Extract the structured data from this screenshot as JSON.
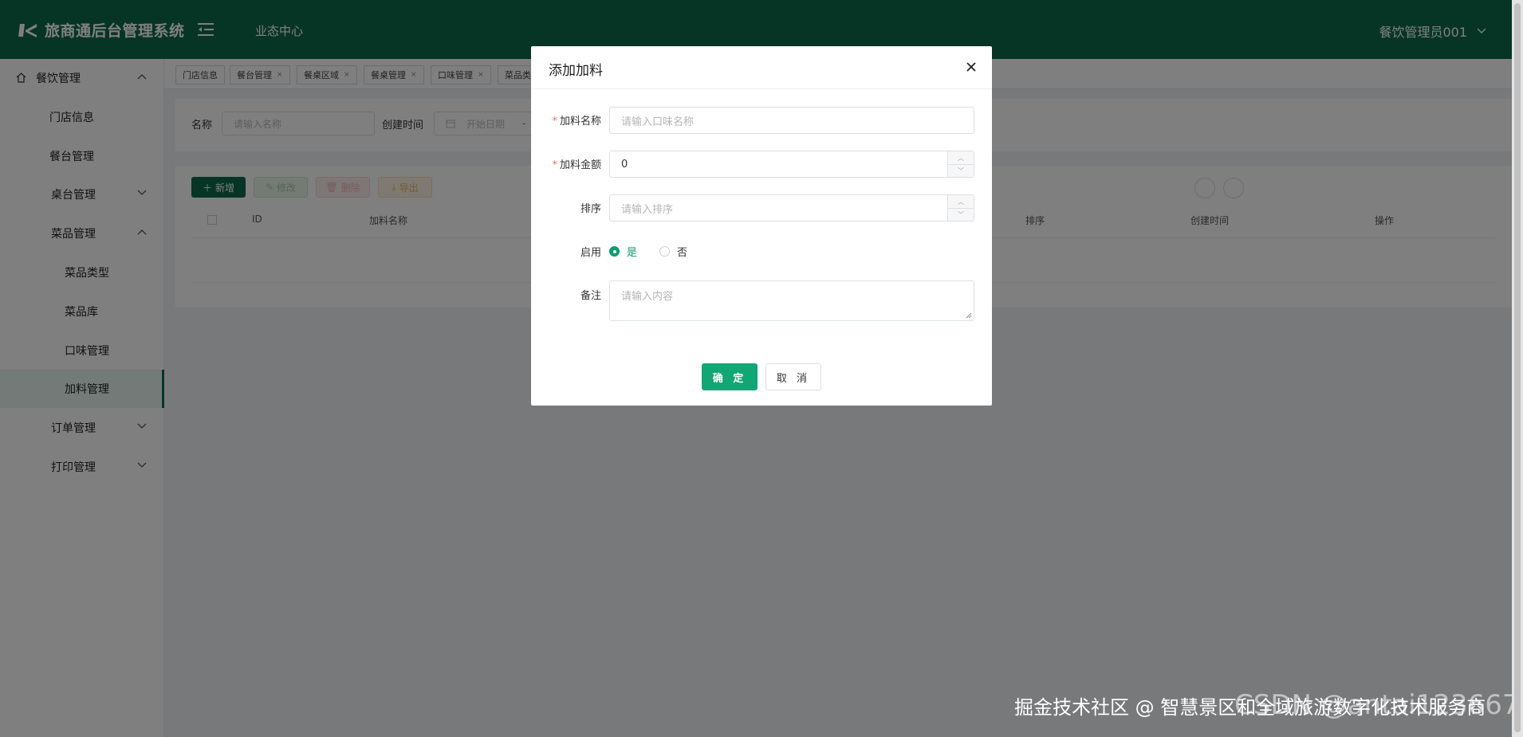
{
  "header": {
    "app_title": "旅商通后台管理系统",
    "center_label": "业态中心",
    "user_name": "餐饮管理员001"
  },
  "sidebar": {
    "items": [
      {
        "label": "餐饮管理",
        "expanded": true
      },
      {
        "label": "门店信息"
      },
      {
        "label": "餐台管理"
      },
      {
        "label": "桌台管理",
        "expanded": false
      },
      {
        "label": "菜品管理",
        "expanded": true
      },
      {
        "label": "菜品类型"
      },
      {
        "label": "菜品库"
      },
      {
        "label": "口味管理"
      },
      {
        "label": "加料管理",
        "active": true
      },
      {
        "label": "订单管理",
        "expanded": false
      },
      {
        "label": "打印管理",
        "expanded": false
      }
    ]
  },
  "tags": [
    "门店信息",
    "餐台管理",
    "餐桌区域",
    "餐桌管理",
    "口味管理",
    "菜品类"
  ],
  "search": {
    "name_label": "名称",
    "name_placeholder": "请输入名称",
    "created_label": "创建时间",
    "start_placeholder": "开始日期",
    "separator": "-"
  },
  "toolbar": {
    "add": "新增",
    "edit": "修改",
    "delete": "删除",
    "export": "导出"
  },
  "table": {
    "columns": [
      "ID",
      "加料名称",
      "排序",
      "创建时间",
      "操作"
    ]
  },
  "dialog": {
    "title": "添加加料",
    "fields": {
      "name_label": "加料名称",
      "name_placeholder": "请输入口味名称",
      "price_label": "加料金额",
      "price_value": "0",
      "sort_label": "排序",
      "sort_placeholder": "请输入排序",
      "enable_label": "启用",
      "enable_yes": "是",
      "enable_no": "否",
      "remark_label": "备注",
      "remark_placeholder": "请输入内容"
    },
    "ok": "确 定",
    "cancel": "取 消"
  },
  "watermark": "掘金技术社区 @ 智慧景区和全域旅游数字化技术服务商",
  "watermark_csdn": "CSDN @antai123667",
  "colors": {
    "brand": "#0d6b4c",
    "primary": "#10a774",
    "required": "#f56c6c"
  }
}
